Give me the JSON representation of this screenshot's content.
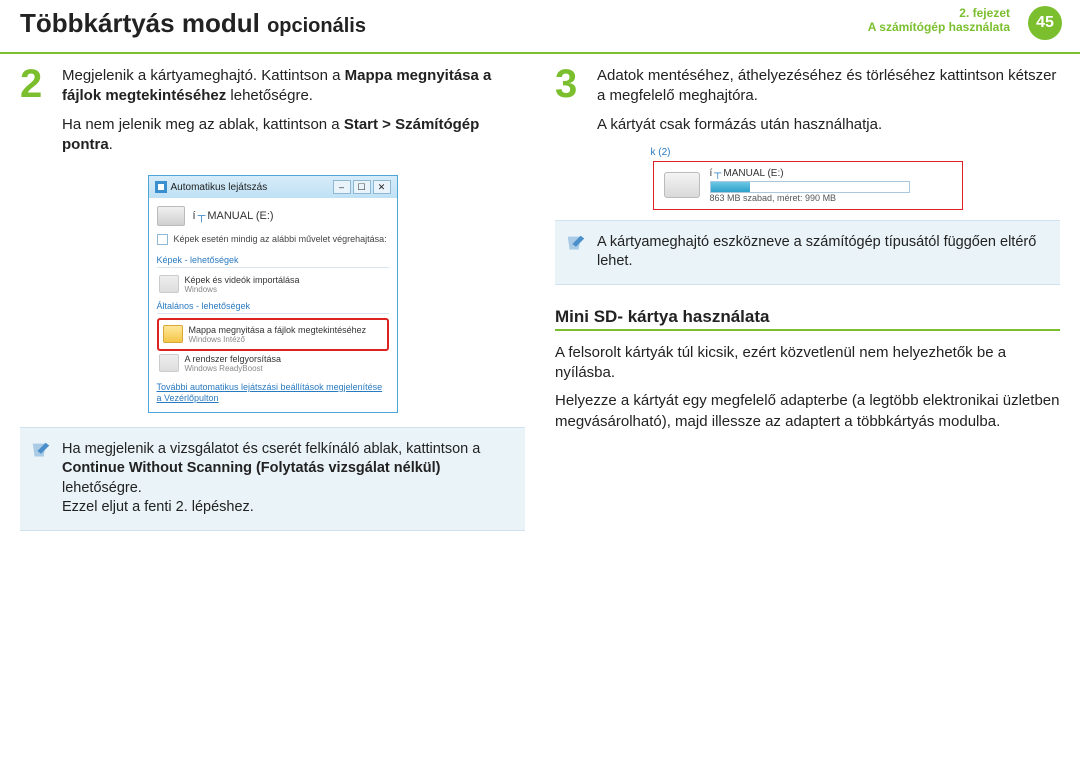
{
  "header": {
    "title_main": "Többkártyás modul",
    "title_sub": "opcionális",
    "chapter_line1": "2. fejezet",
    "chapter_line2": "A számítógép használata",
    "page_number": "45"
  },
  "left": {
    "step_num": "2",
    "p1_a": "Megjelenik a kártyameghajtó. Kattintson a ",
    "p1_b": "Mappa megnyitása a fájlok megtekintéséhez",
    "p1_c": " lehetőségre.",
    "p2_a": "Ha nem jelenik meg az ablak, kattintson a ",
    "p2_b": "Start > Számítógép pontra",
    "p2_c": ".",
    "autoplay": {
      "title": "Automatikus lejátszás",
      "drive": "MANUAL (E:)",
      "checkbox": "Képek esetén mindig az alábbi művelet végrehajtása:",
      "sec1": "Képek - lehetőségek",
      "opt1": "Képek és videók importálása",
      "opt1_sub": "Windows",
      "sec2": "Általános - lehetőségek",
      "opt2": "Mappa megnyitása a fájlok megtekintéséhez",
      "opt2_sub": "Windows Intéző",
      "opt3": "A rendszer felgyorsítása",
      "opt3_sub": "Windows ReadyBoost",
      "link": "További automatikus lejátszási beállítások megjelenítése a Vezérlőpulton"
    },
    "note_a": "Ha megjelenik a vizsgálatot és cserét felkínáló ablak, kattintson a ",
    "note_b": "Continue Without Scanning (Folytatás vizsgálat nélkül)",
    "note_c": " lehetőségre.",
    "note_d": "Ezzel eljut a fenti 2. lépéshez."
  },
  "right": {
    "step_num": "3",
    "p1": "Adatok mentéséhez, áthelyezéséhez és törléséhez kattintson kétszer a megfelelő meghajtóra.",
    "p2": "A kártyát csak formázás után használhatja.",
    "drive": {
      "k2": "k (2)",
      "name": "MANUAL (E:)",
      "sub": "863 MB szabad, méret: 990 MB"
    },
    "note": "A kártyameghajtó eszközneve a számítógép típusától függően eltérő lehet.",
    "h2": "Mini SD- kártya használata",
    "p3": "A felsorolt kártyák túl kicsik, ezért közvetlenül nem helyezhetők be a nyílásba.",
    "p4": "Helyezze a kártyát egy megfelelő adapterbe (a legtöbb elektronikai üzletben megvásárolható), majd illessze az adaptert a többkártyás modulba."
  }
}
